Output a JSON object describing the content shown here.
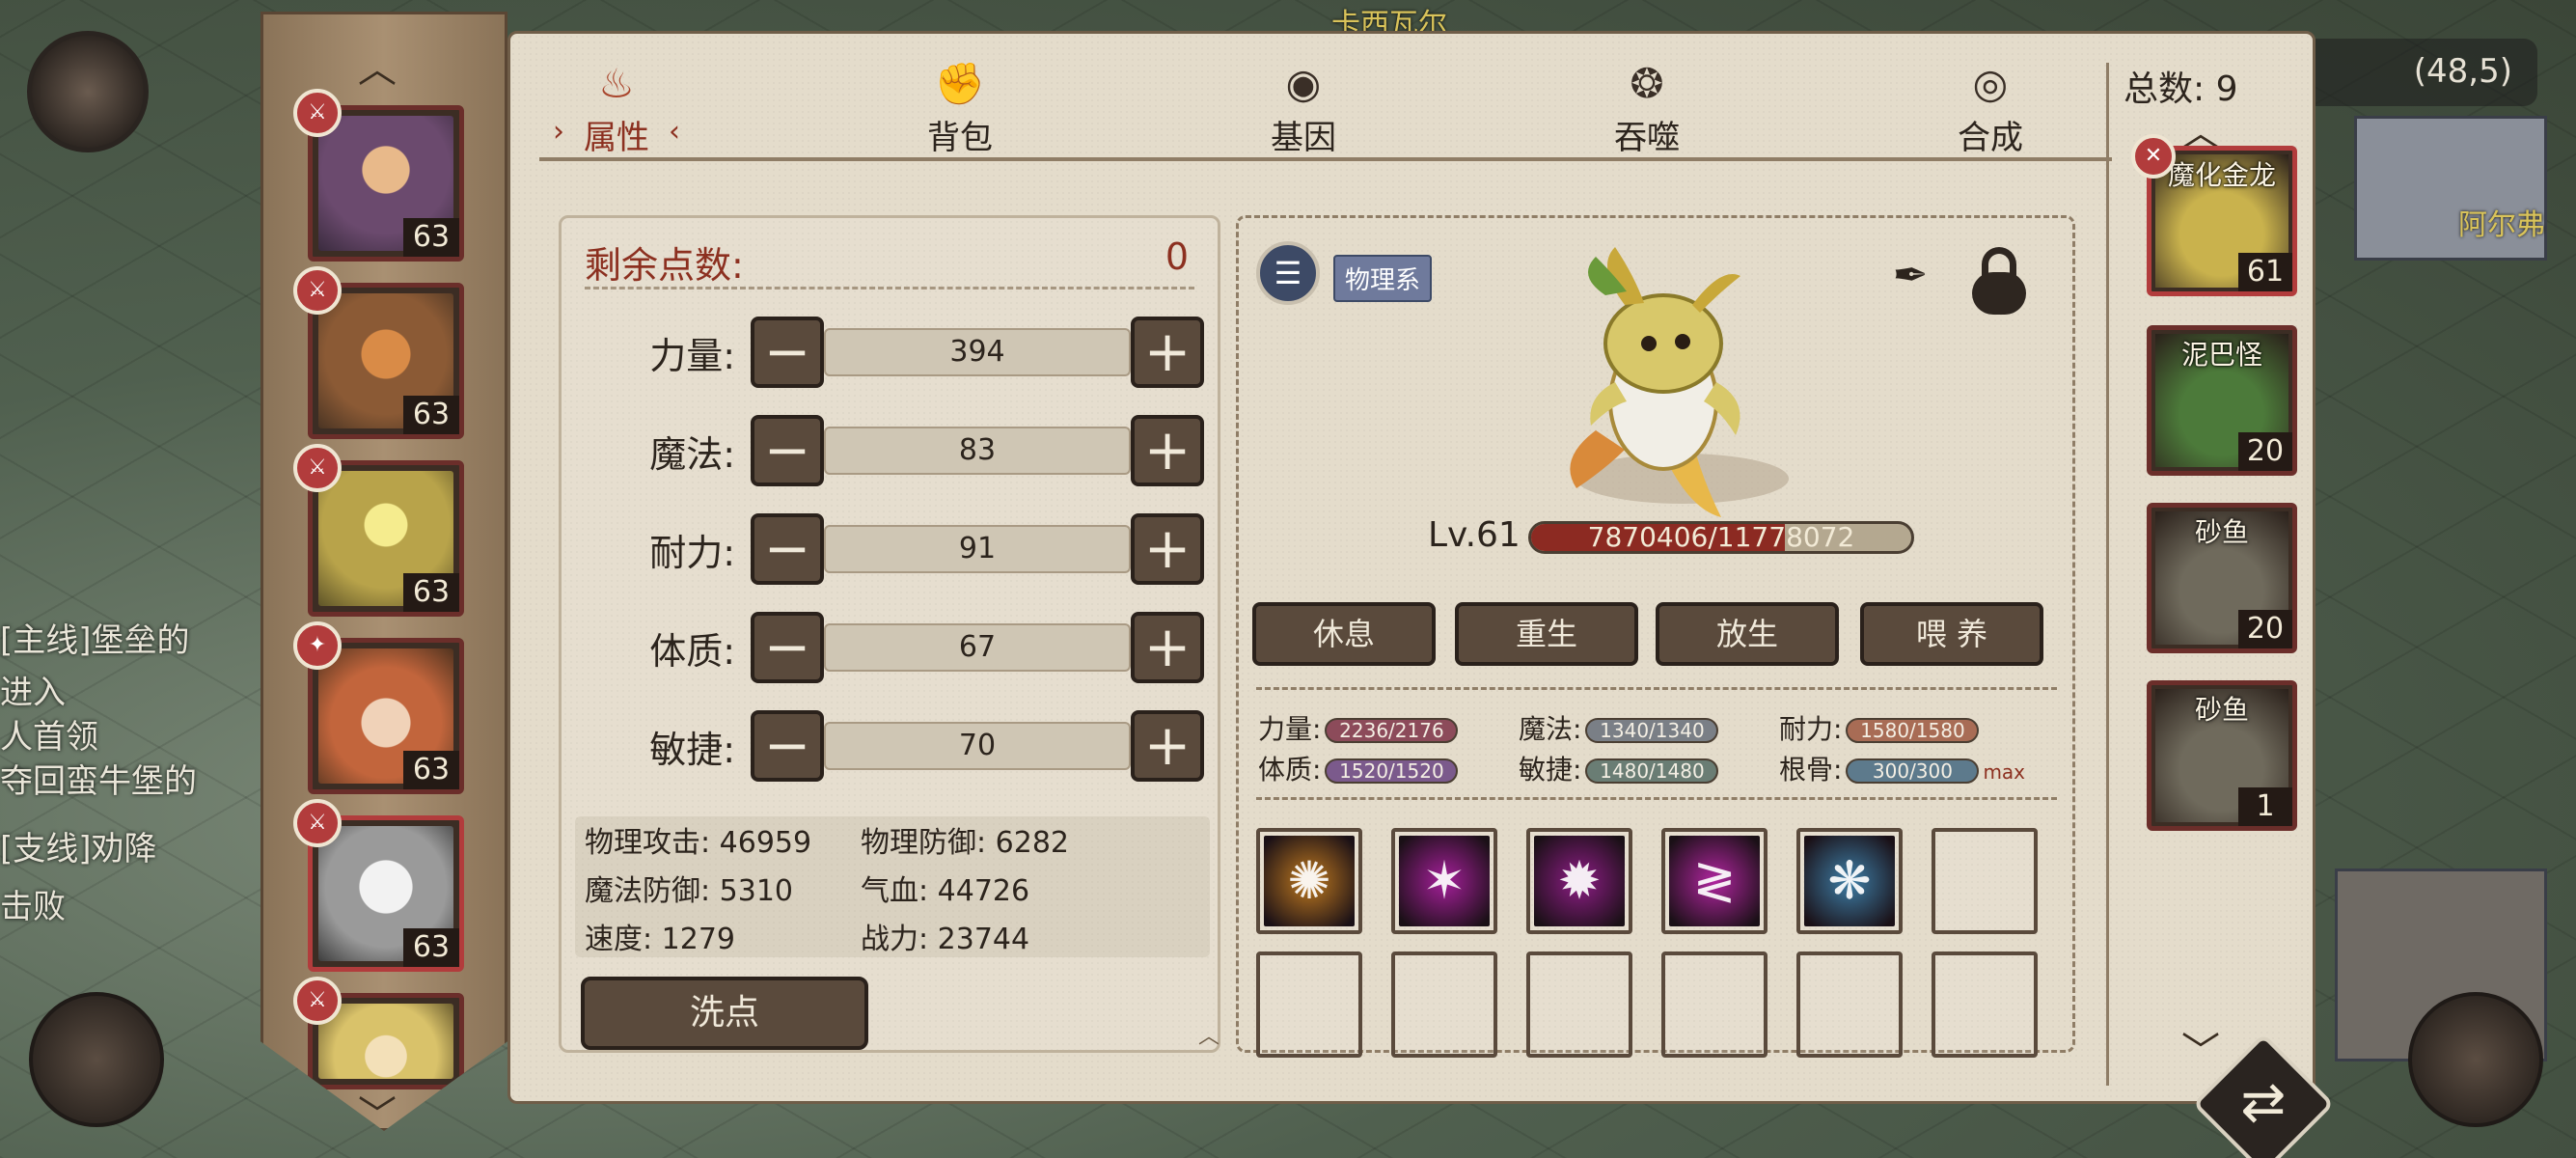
{
  "tabs": [
    {
      "label": "属性",
      "icon": "fire-icon",
      "active": true
    },
    {
      "label": "背包",
      "icon": "bag-icon",
      "active": false
    },
    {
      "label": "基因",
      "icon": "gene-icon",
      "active": false
    },
    {
      "label": "吞噬",
      "icon": "devour-icon",
      "active": false
    },
    {
      "label": "合成",
      "icon": "synthesis-icon",
      "active": false
    }
  ],
  "stats": {
    "remaining_label": "剩余点数:",
    "remaining_value": "0",
    "attributes": [
      {
        "name": "力量:",
        "value": "394"
      },
      {
        "name": "魔法:",
        "value": "83"
      },
      {
        "name": "耐力:",
        "value": "91"
      },
      {
        "name": "体质:",
        "value": "67"
      },
      {
        "name": "敏捷:",
        "value": "70"
      }
    ],
    "derived": {
      "phys_atk": "物理攻击: 46959",
      "phys_def": "物理防御: 6282",
      "mag_def": "魔法防御: 5310",
      "hp": "气血: 44726",
      "speed": "速度: 1279",
      "power": "战力: 23744"
    },
    "reset_label": "洗点"
  },
  "pet": {
    "type_badge": "物理系",
    "level": "Lv.61",
    "hp_text": "7870406/11778072",
    "hp_fraction": 0.668,
    "actions": [
      "休息",
      "重生",
      "放生",
      "喂 养"
    ],
    "caps": [
      {
        "label": "力量:",
        "value": "2236/2176",
        "color": "#8c4b5a"
      },
      {
        "label": "魔法:",
        "value": "1340/1340",
        "color": "#7a7f86"
      },
      {
        "label": "耐力:",
        "value": "1580/1580",
        "color": "#a86c55"
      },
      {
        "label": "体质:",
        "value": "1520/1520",
        "color": "#7b5a8c"
      },
      {
        "label": "敏捷:",
        "value": "1480/1480",
        "color": "#6a7d74"
      },
      {
        "label": "根骨:",
        "value": "300/300",
        "color": "#5d7a8c"
      }
    ],
    "max_tag": "max",
    "skills": [
      {
        "icon": "golden-claw-icon",
        "color": "#c07a20"
      },
      {
        "icon": "pink-slash-icon",
        "color": "#a51f9a"
      },
      {
        "icon": "purple-burst-icon",
        "color": "#8e1d86"
      },
      {
        "icon": "pink-strike-icon",
        "color": "#b0259f"
      },
      {
        "icon": "blue-crystal-icon",
        "color": "#3e7fa8"
      }
    ]
  },
  "rail": {
    "total_label": "总数: 9",
    "pets": [
      {
        "name": "魔化金龙",
        "level": "61",
        "color": "#c9b24d"
      },
      {
        "name": "泥巴怪",
        "level": "20",
        "color": "#4c7a3a"
      },
      {
        "name": "砂鱼",
        "level": "20",
        "color": "#6f6a5c"
      },
      {
        "name": "砂鱼",
        "level": "1",
        "color": "#6f6a5c"
      }
    ]
  },
  "roster": {
    "pets": [
      {
        "level": "63",
        "color": "#6b4a6e"
      },
      {
        "level": "63",
        "color": "#8b5a35"
      },
      {
        "level": "63",
        "color": "#b8a34a"
      },
      {
        "level": "63",
        "color": "#c2653c"
      },
      {
        "level": "63",
        "color": "#9a9a9a"
      },
      {
        "level": "",
        "color": "#d9c26a"
      }
    ]
  },
  "background": {
    "coord": "(48,5)",
    "quest_main": "[主线]堡垒的",
    "quest_line1": "进入",
    "quest_line2": "人首领",
    "quest_line3": "夺回蛮牛堡的",
    "quest_branch": "[支线]劝降",
    "quest_branch_line": "击败",
    "top_label": "卡西瓦尔",
    "right_label": "阿尔弗"
  }
}
